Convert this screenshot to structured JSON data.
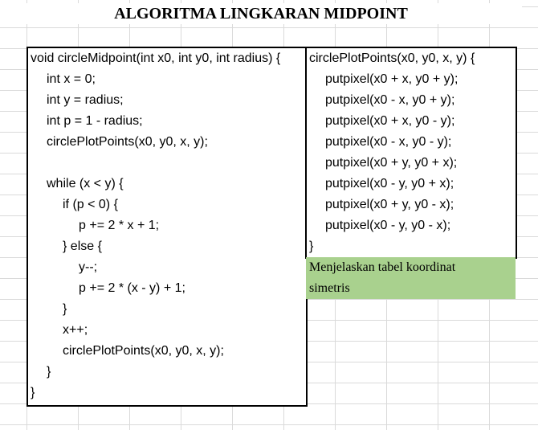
{
  "title": "ALGORITMA LINGKARAN MIDPOINT",
  "left_code": [
    {
      "text": "void circleMidpoint(int x0, int y0, int radius) {",
      "indent": 0
    },
    {
      "text": "int x = 0;",
      "indent": 1
    },
    {
      "text": "int y = radius;",
      "indent": 1
    },
    {
      "text": "int p = 1 - radius;",
      "indent": 1
    },
    {
      "text": "circlePlotPoints(x0, y0, x, y);",
      "indent": 1
    },
    {
      "text": "",
      "indent": 0
    },
    {
      "text": "while (x < y) {",
      "indent": 1
    },
    {
      "text": "if (p < 0) {",
      "indent": 2
    },
    {
      "text": "p += 2 * x + 1;",
      "indent": 3
    },
    {
      "text": "} else {",
      "indent": 2
    },
    {
      "text": "y--;",
      "indent": 3
    },
    {
      "text": "p += 2 * (x - y) + 1;",
      "indent": 3
    },
    {
      "text": "}",
      "indent": 2
    },
    {
      "text": "x++;",
      "indent": 2
    },
    {
      "text": "circlePlotPoints(x0, y0, x, y);",
      "indent": 2
    },
    {
      "text": "}",
      "indent": 1
    },
    {
      "text": "}",
      "indent": 0
    }
  ],
  "right_code": [
    {
      "text": "circlePlotPoints(x0, y0, x, y) {",
      "indent": 0
    },
    {
      "text": "putpixel(x0 + x, y0 + y);",
      "indent": 1
    },
    {
      "text": "putpixel(x0 - x, y0 + y);",
      "indent": 1
    },
    {
      "text": "putpixel(x0 + x, y0 - y);",
      "indent": 1
    },
    {
      "text": "putpixel(x0 - x, y0 - y);",
      "indent": 1
    },
    {
      "text": "putpixel(x0 + y, y0 + x);",
      "indent": 1
    },
    {
      "text": "putpixel(x0 - y, y0 + x);",
      "indent": 1
    },
    {
      "text": "putpixel(x0 + y, y0 - x);",
      "indent": 1
    },
    {
      "text": "putpixel(x0 - y, y0 - x);",
      "indent": 1
    },
    {
      "text": "}",
      "indent": 0
    }
  ],
  "note": {
    "line1": "Menjelaskan tabel koordinat",
    "line2": "simetris",
    "color": "#a9d18e"
  }
}
